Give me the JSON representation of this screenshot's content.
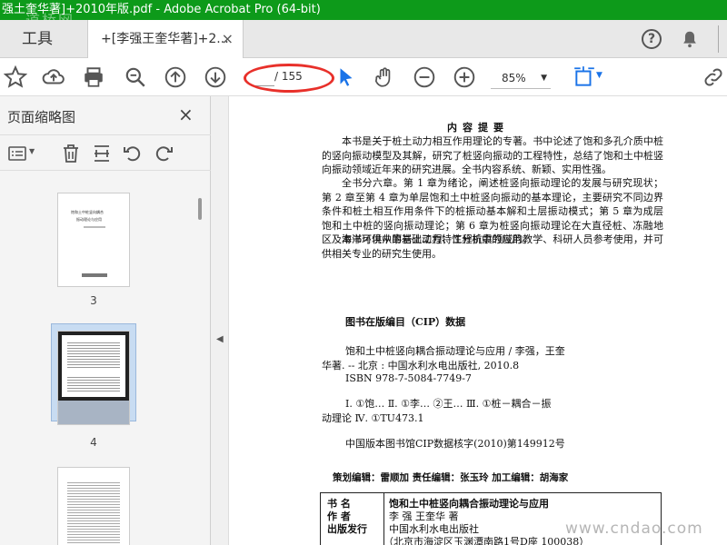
{
  "titlebar": {
    "title": "强土奎华著]+2010年版.pdf - Adobe Acrobat Pro (64-bit)",
    "watermark": "道桥网"
  },
  "tabs": {
    "tools_label": "工具",
    "doc_label": "+[李强王奎华著]+2...",
    "close_glyph": "×"
  },
  "toolbar": {
    "page_current": "",
    "page_total": "/ 155",
    "zoom": "85%"
  },
  "left_panel": {
    "title": "页面缩略图",
    "close_glyph": "×",
    "thumbnails": [
      {
        "label": "3",
        "title_line1": "饱和土中桩竖向耦合",
        "title_line2": "振动理论与应用"
      },
      {
        "label": "4"
      },
      {
        "label": ""
      }
    ]
  },
  "document": {
    "heading": "内容提要",
    "para1": "本书是关于桩土动力相互作用理论的专著。书中论述了饱和多孔介质中桩的竖向振动模型及其解，研究了桩竖向振动的工程特性，总结了饱和土中桩竖向振动领域近年来的研究进展。全书内容系统、新颖、实用性强。",
    "para2": "全书分六章。第 1 章为绪论，阐述桩竖向振动理论的发展与研究现状；第 2 章至第 4 章为单层饱和土中桩竖向振动的基本理论，主要研究不同边界条件和桩土相互作用条件下的桩振动基本解和土层振动模式；第 5 章为成层饱和土中桩的竖向振动理论；第 6 章为桩竖向振动理论在大直径桩、冻融地区及海洋环境中的基础动力特性分析中的应用。",
    "para3": "本书可供从事岩土工程、工程抗震领域的教学、科研人员参考使用，并可供相关专业的研究生使用。",
    "cip_title": "图书在版编目（CIP）数据",
    "cip_line1": "饱和土中桩竖向耦合振动理论与应用 / 李强，王奎",
    "cip_line2": "华著. -- 北京 : 中国水利水电出版社, 2010.8",
    "cip_line3": "ISBN 978-7-5084-7749-7",
    "cip_line4": "Ⅰ. ①饱… Ⅱ. ①李… ②王… Ⅲ. ①桩－耦合－振",
    "cip_line5": "动理论 Ⅳ. ①TU473.1",
    "cip_line6": "中国版本图书馆CIP数据核字(2010)第149912号",
    "editors_line": "策划编辑：雷顺加  责任编辑：张玉玲   加工编辑：胡海家",
    "table": {
      "row1_label": "书  名",
      "row1_value": "饱和土中桩竖向耦合振动理论与应用",
      "row2_label": "作  者",
      "row2_value": "李  强  王奎华  著",
      "row3_label": "出版发行",
      "row3_value": "中国水利水电出版社",
      "row4_value": "（北京市海淀区玉渊潭南路1号D座 100038）"
    },
    "watermark": "www.cndao.com"
  },
  "colors": {
    "titlebar": "#0d9a1a",
    "annotation_oval": "#e8302a",
    "accent_blue": "#1a73e8"
  }
}
